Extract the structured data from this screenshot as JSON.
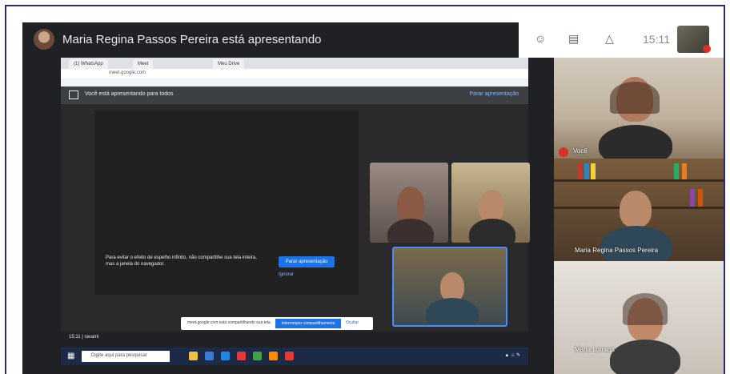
{
  "header": {
    "presenting_text": "Maria Regina Passos Pereira está apresentando",
    "clock": "15:11",
    "icons": [
      "people-icon",
      "chat-icon",
      "activities-icon"
    ]
  },
  "shared_screen": {
    "browser_tabs": [
      "(1) WhatsApp",
      "Meet",
      "Meu Drive"
    ],
    "url": "meet.google.com",
    "inner_present_text": "Você está apresentando para todos",
    "inner_stop_text": "Parar apresentação",
    "tip_text": "Para evitar o efeito de espelho infinito, não compartilhe sua tela inteira, mas a janela do navegador.",
    "tip_button": "Parar apresentação",
    "tip_ignore": "Ignorar",
    "inner_time": "15:11 | ravami",
    "notification_text": "meet.google.com está compartilhando sua tela.",
    "notification_button": "Interromper compartilhamento",
    "notification_hide": "Ocultar",
    "taskbar_search": "Digite aqui para pesquisar"
  },
  "participants": {
    "self_label": "Você",
    "tile2_name": "Maria Regina Passos Pereira",
    "tile3_name": "Maria Lorrana"
  }
}
